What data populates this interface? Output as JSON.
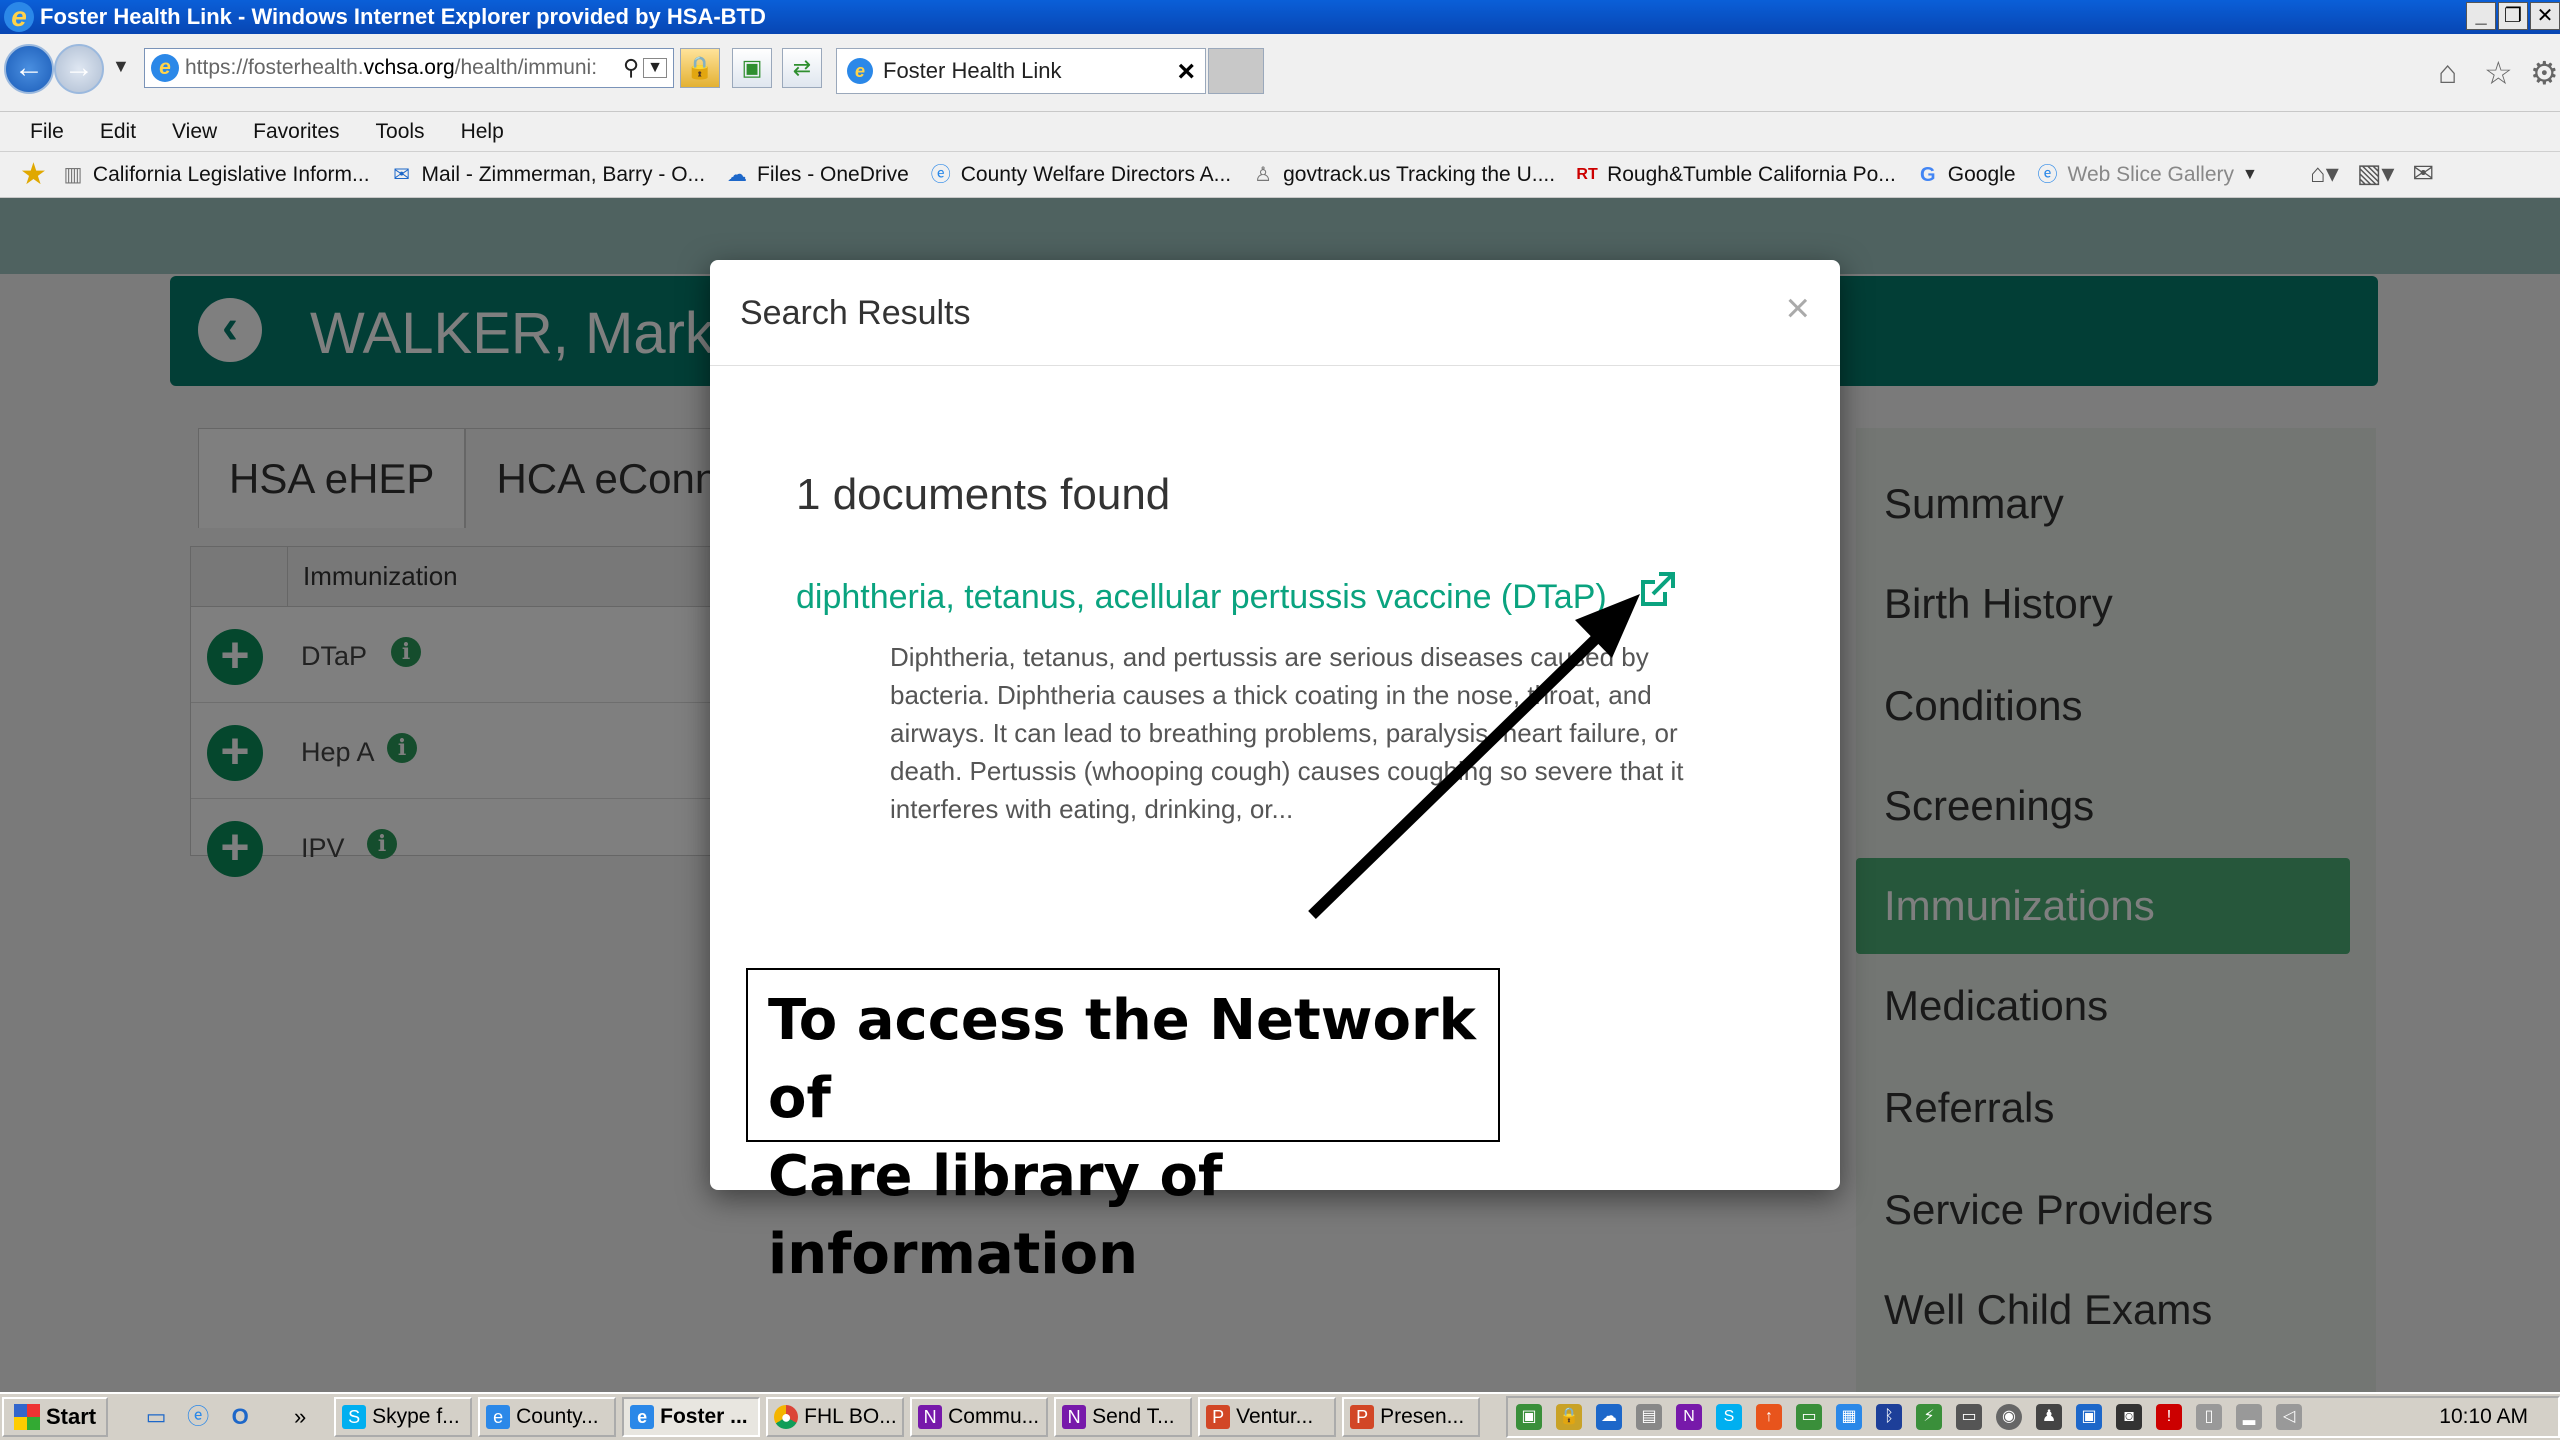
{
  "window": {
    "title": "Foster Health Link - Windows Internet Explorer provided by HSA-BTD"
  },
  "browser": {
    "url_prefix": "https://",
    "url_host_pre": "fosterhealth.",
    "url_host_main": "vchsa.org",
    "url_path": "/health/immuni:",
    "tab_title": "Foster Health Link",
    "tab_close": "×"
  },
  "menu": [
    "File",
    "Edit",
    "View",
    "Favorites",
    "Tools",
    "Help"
  ],
  "favorites": [
    "California Legislative Inform...",
    "Mail - Zimmerman, Barry - O...",
    "Files - OneDrive",
    "County Welfare Directors A...",
    "govtrack.us Tracking the U....",
    "Rough&Tumble California Po...",
    "Google",
    "Web Slice Gallery"
  ],
  "page": {
    "patient_name": "WALKER, Mark",
    "tabs": [
      "HSA eHEP",
      "HCA eConn"
    ],
    "table_header": "Immunization",
    "immunizations": [
      "DTaP",
      "Hep A",
      "IPV"
    ],
    "side_nav": [
      "Summary",
      "Birth History",
      "Conditions",
      "Screenings",
      "Immunizations",
      "Medications",
      "Referrals",
      "Service Providers",
      "Well Child Exams"
    ],
    "side_nav_active": "Immunizations"
  },
  "modal": {
    "title": "Search Results",
    "close": "×",
    "found": "1 documents found",
    "result_title": "diphtheria, tetanus, acellular pertussis vaccine (DTaP)",
    "result_desc": "Diphtheria, tetanus, and pertussis are serious diseases caused by bacteria. Diphtheria causes a thick coating in the nose, throat, and airways. It can lead to breathing problems, paralysis, heart failure, or death. Pertussis (whooping cough) causes coughing so severe that it interferes with eating, drinking, or..."
  },
  "callout": {
    "line1": "To access the Network of",
    "line2": "Care library of information"
  },
  "taskbar": {
    "start": "Start",
    "more": "»",
    "tasks": [
      "Skype f...",
      "County...",
      "Foster ...",
      "FHL BO...",
      "Commu...",
      "Send T...",
      "Ventur...",
      "Presen..."
    ],
    "active_task": "Foster ...",
    "clock": "10:10 AM"
  },
  "colors": {
    "accent": "#057d6d",
    "link": "#0aa37f",
    "active_nav": "#4caf77",
    "add_button": "#0a8f5a"
  }
}
